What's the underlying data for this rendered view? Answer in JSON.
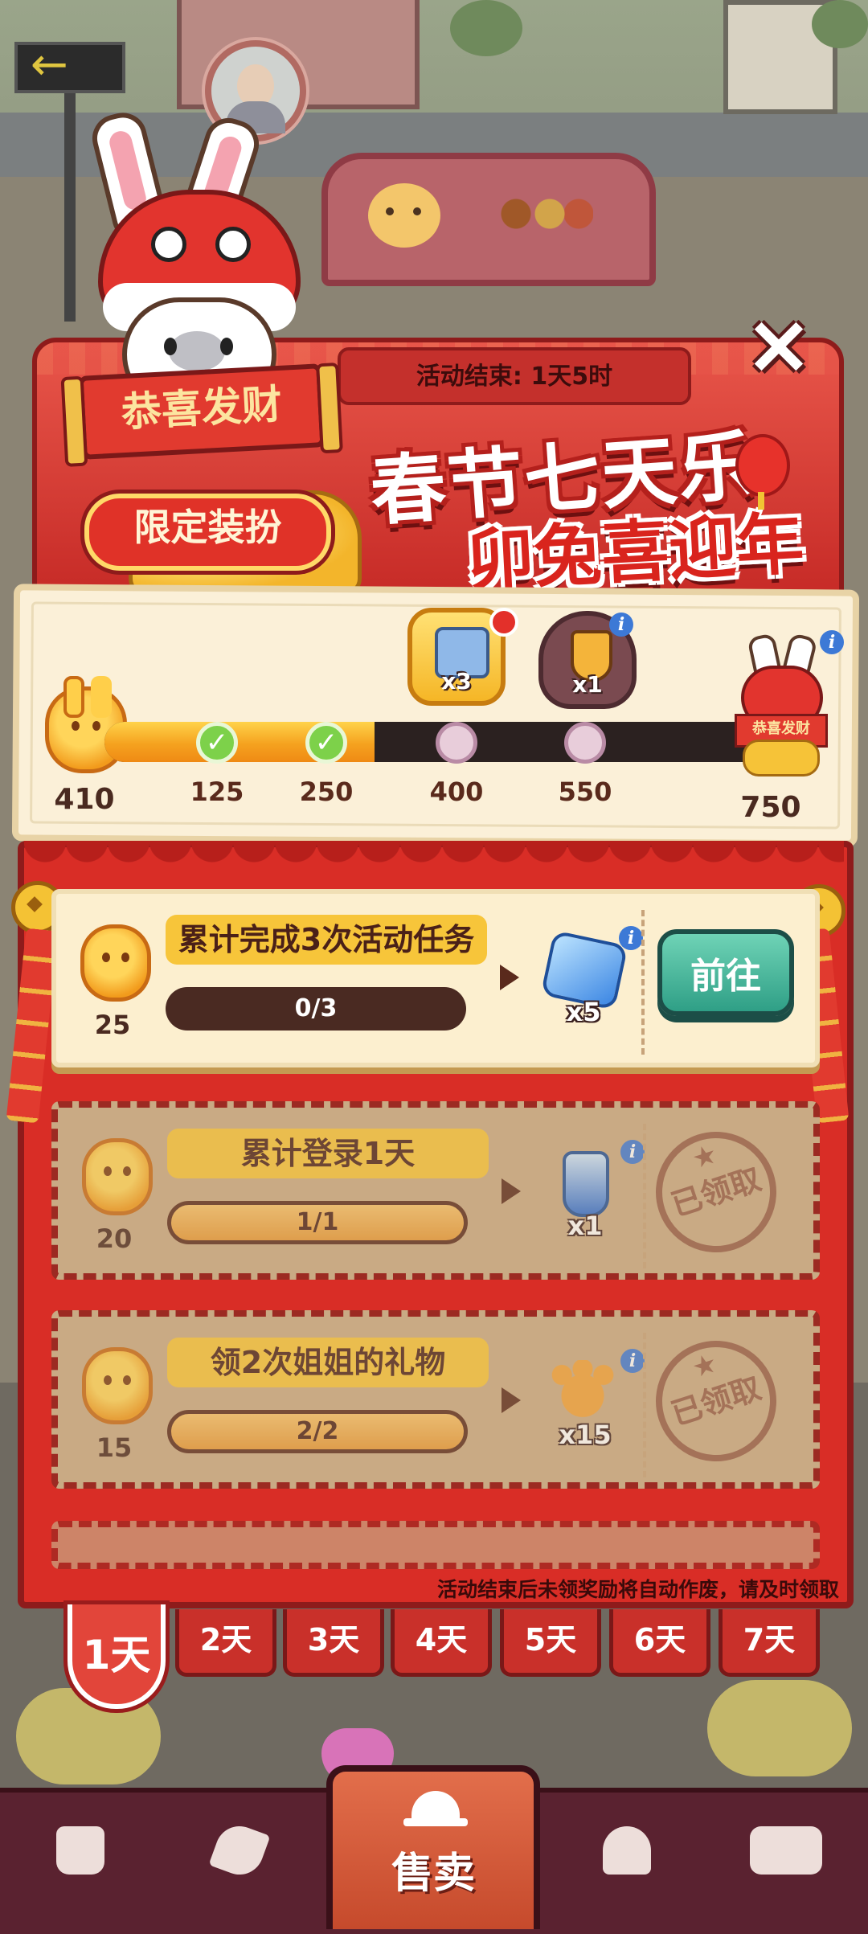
{
  "event": {
    "countdown": "活动结束: 1天5时",
    "title_line1": "春节七天乐",
    "title_line2": "卯兔喜迎年",
    "mascot_scroll": "恭喜发财",
    "limited_label": "限定装扮",
    "close_icon": "close-icon"
  },
  "progress": {
    "current_score": "410",
    "max_score": "750",
    "fill_fraction": 0.41,
    "checkpoints": [
      {
        "label": "125",
        "state": "done"
      },
      {
        "label": "250",
        "state": "done"
      },
      {
        "label": "400",
        "state": "todo"
      },
      {
        "label": "550",
        "state": "todo"
      }
    ],
    "milestones": [
      {
        "qty": "x3",
        "icon": "treasure-box-icon"
      },
      {
        "qty": "x1",
        "icon": "trophy-cup-icon"
      }
    ],
    "final_scroll": "恭喜发财"
  },
  "tasks": [
    {
      "points": "25",
      "title": "累计完成3次活动任务",
      "progress": "0/3",
      "reward_qty": "x5",
      "reward_icon": "gem-icon",
      "action": "前往",
      "state": "active"
    },
    {
      "points": "20",
      "title": "累计登录1天",
      "progress": "1/1",
      "reward_qty": "x1",
      "reward_icon": "potion-icon",
      "action": "已领取",
      "state": "claimed"
    },
    {
      "points": "15",
      "title": "领2次姐姐的礼物",
      "progress": "2/2",
      "reward_qty": "x15",
      "reward_icon": "paw-cookie-icon",
      "action": "已领取",
      "state": "claimed"
    }
  ],
  "footer_note": "活动结束后未领奖励将自动作废，请及时领取",
  "days": [
    "1天",
    "2天",
    "3天",
    "4天",
    "5天",
    "6天",
    "7天"
  ],
  "bottom_nav": {
    "sell_label": "售卖"
  },
  "colors": {
    "panel_red": "#d92d26",
    "gold": "#f7c53a",
    "go_button": "#2f9f86",
    "nav_bg": "#5a2230"
  }
}
